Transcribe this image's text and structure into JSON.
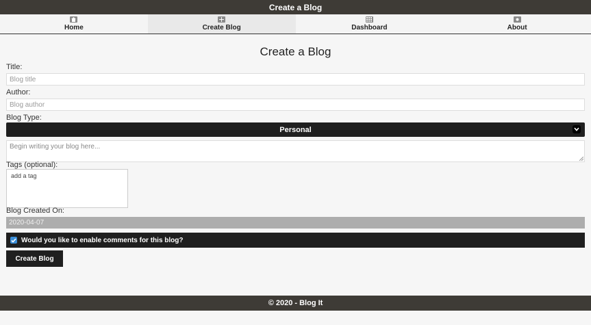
{
  "header": {
    "title": "Create a Blog"
  },
  "nav": {
    "items": [
      {
        "label": "Home",
        "icon": "home-icon"
      },
      {
        "label": "Create Blog",
        "icon": "plus-square-icon"
      },
      {
        "label": "Dashboard",
        "icon": "grid-icon"
      },
      {
        "label": "About",
        "icon": "info-square-icon"
      }
    ],
    "active": "Create Blog"
  },
  "form": {
    "heading": "Create a Blog",
    "title_label": "Title:",
    "title_placeholder": "Blog title",
    "author_label": "Author:",
    "author_placeholder": "Blog author",
    "type_label": "Blog Type:",
    "type_value": "Personal",
    "body_placeholder": "Begin writing your blog here...",
    "tags_label": "Tags (optional):",
    "tags_placeholder": "add a tag",
    "created_label": "Blog Created On:",
    "created_value": "2020-04-07",
    "comments_label": "Would you like to enable comments for this blog?",
    "comments_checked": true,
    "submit_label": "Create Blog"
  },
  "footer": {
    "text": "© 2020 - Blog It"
  },
  "colors": {
    "dark": "#1f1f1f",
    "bar": "#3e3b36",
    "check": "#3b8ed8"
  }
}
